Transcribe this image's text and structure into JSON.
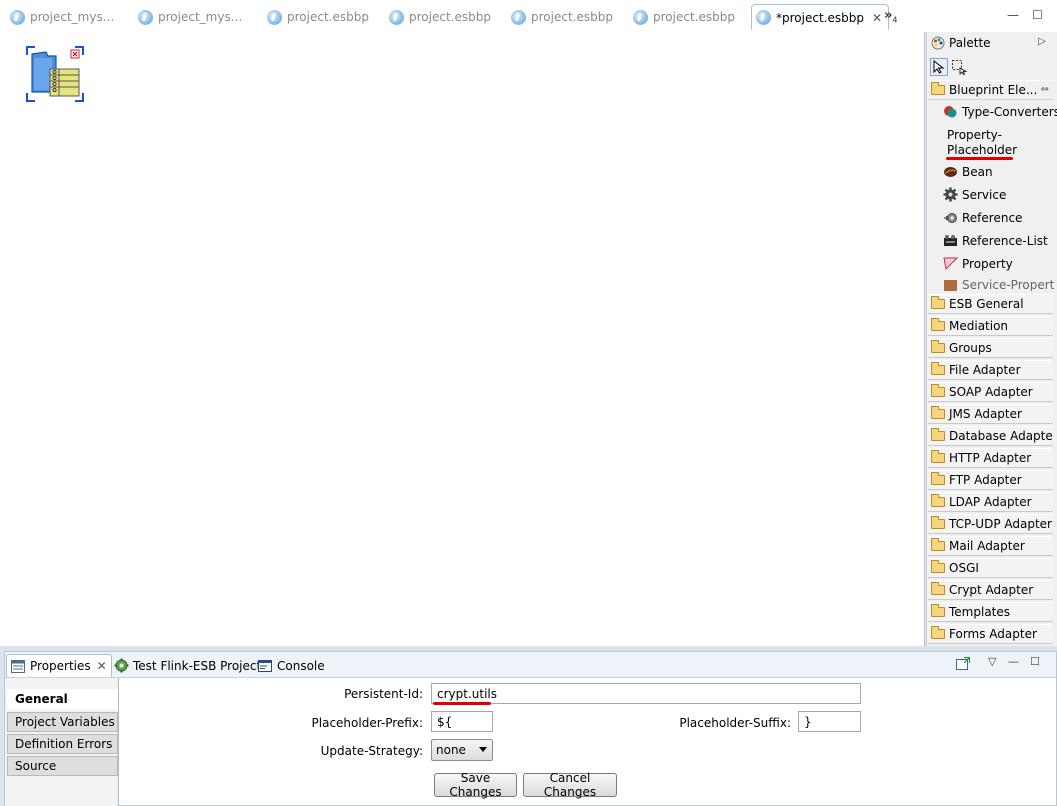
{
  "editor_tabs": [
    {
      "label": "project_mys..."
    },
    {
      "label": "project_mys..."
    },
    {
      "label": "project.esbbp"
    },
    {
      "label": "project.esbbp"
    },
    {
      "label": "project.esbbp"
    },
    {
      "label": "project.esbbp"
    },
    {
      "label": "*project.esbbp",
      "active": true
    }
  ],
  "tab_overflow": {
    "glyph": "»",
    "count": "4"
  },
  "palette": {
    "title": "Palette",
    "open_drawer": "Blueprint Ele...",
    "items": [
      {
        "label": "Type-Converters",
        "icon": "type-converters-icon"
      },
      {
        "label": "Property-Placeholder",
        "icon": "none"
      },
      {
        "label": "Bean",
        "icon": "bean-icon"
      },
      {
        "label": "Service",
        "icon": "gear-icon"
      },
      {
        "label": "Reference",
        "icon": "reference-icon"
      },
      {
        "label": "Reference-List",
        "icon": "reference-list-icon"
      },
      {
        "label": "Property",
        "icon": "property-icon"
      },
      {
        "label": "Service-Property",
        "icon": "service-property-icon"
      }
    ],
    "drawers": [
      "ESB General",
      "Mediation",
      "Groups",
      "File Adapter",
      "SOAP Adapter",
      "JMS Adapter",
      "Database Adapter",
      "HTTP Adapter",
      "FTP Adapter",
      "LDAP Adapter",
      "TCP-UDP Adapter",
      "Mail Adapter",
      "OSGI",
      "Crypt Adapter",
      "Templates",
      "Forms Adapter"
    ]
  },
  "bottom_tabs": [
    {
      "label": "Properties",
      "active": true
    },
    {
      "label": "Test Flink-ESB Project"
    },
    {
      "label": "Console"
    }
  ],
  "property_sections": [
    "General",
    "Project Variables",
    "Definition Errors",
    "Source"
  ],
  "form": {
    "persistent_id_label": "Persistent-Id:",
    "persistent_id_value": "crypt.utils",
    "prefix_label": "Placeholder-Prefix:",
    "prefix_value": "${",
    "suffix_label": "Placeholder-Suffix:",
    "suffix_value": "}",
    "update_strategy_label": "Update-Strategy:",
    "update_strategy_value": "none",
    "save_label": "Save Changes",
    "cancel_label": "Cancel Changes"
  },
  "colors": {
    "highlight": "#e00000",
    "accent": "#5a98cf"
  }
}
